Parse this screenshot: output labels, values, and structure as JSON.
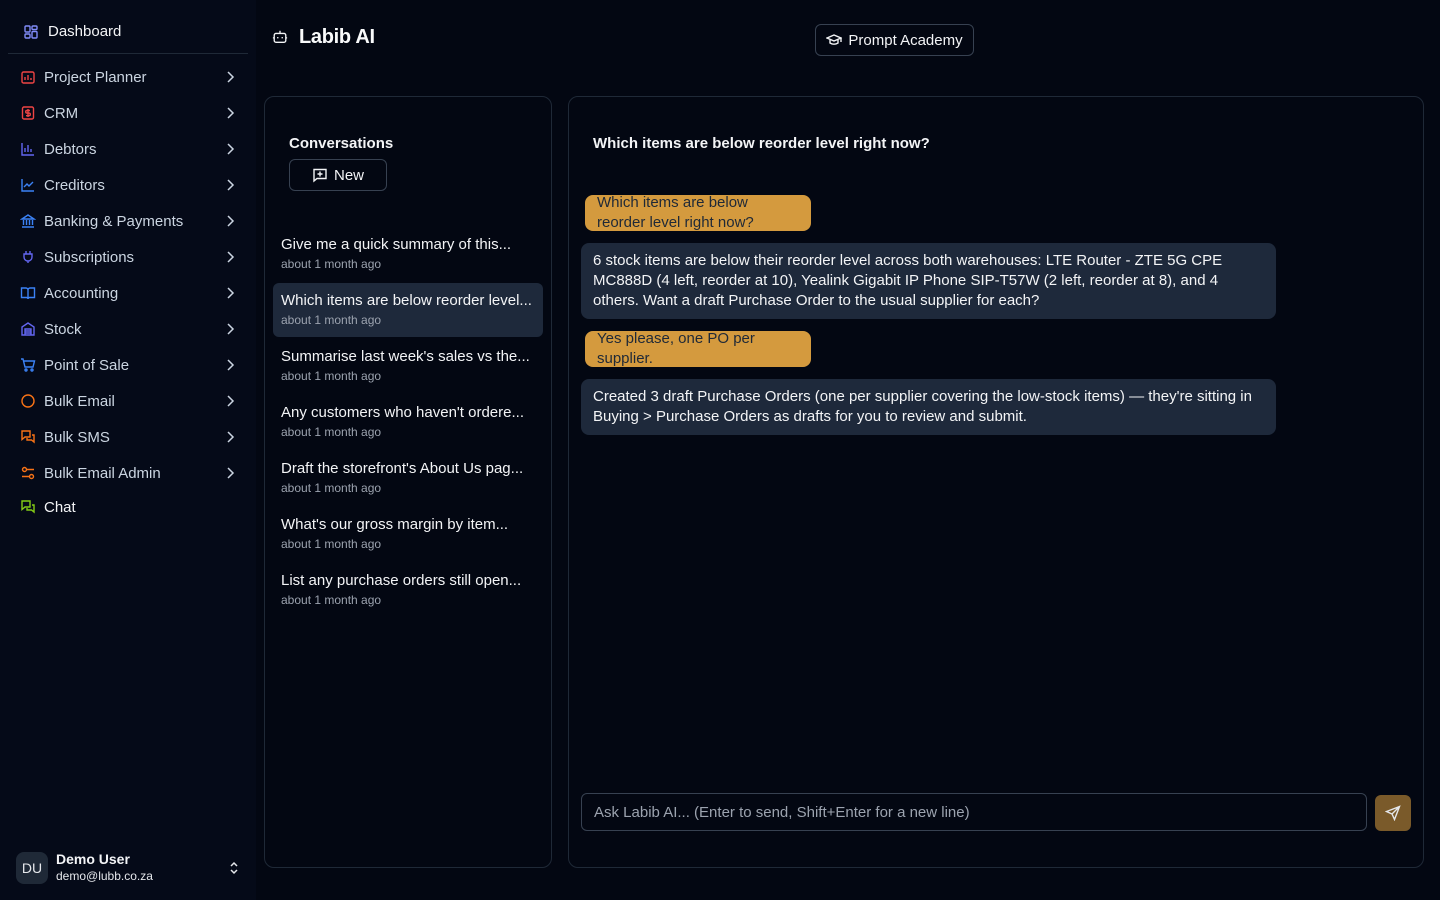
{
  "sidebar": {
    "dashboard": {
      "label": "Dashboard",
      "icon": "dashboard-icon",
      "color": "#818cf8"
    },
    "items": [
      {
        "label": "Project Planner",
        "icon": "calendar-chart-icon",
        "color": "#ef4444"
      },
      {
        "label": "CRM",
        "icon": "dollar-card-icon",
        "color": "#ef4444"
      },
      {
        "label": "Debtors",
        "icon": "bar-chart-icon",
        "color": "#6366f1"
      },
      {
        "label": "Creditors",
        "icon": "trend-chart-icon",
        "color": "#3b82f6"
      },
      {
        "label": "Banking & Payments",
        "icon": "bank-icon",
        "color": "#3b82f6"
      },
      {
        "label": "Subscriptions",
        "icon": "plug-icon",
        "color": "#6366f1"
      },
      {
        "label": "Accounting",
        "icon": "book-icon",
        "color": "#3b82f6"
      },
      {
        "label": "Stock",
        "icon": "warehouse-icon",
        "color": "#6366f1"
      },
      {
        "label": "Point of Sale",
        "icon": "cart-icon",
        "color": "#3b82f6"
      },
      {
        "label": "Bulk Email",
        "icon": "circle-icon",
        "color": "#f97316"
      },
      {
        "label": "Bulk SMS",
        "icon": "chat-bubbles-icon",
        "color": "#f97316"
      },
      {
        "label": "Bulk Email Admin",
        "icon": "sliders-icon",
        "color": "#f97316"
      },
      {
        "label": "Chat",
        "icon": "chat-icon",
        "color": "#84cc16"
      }
    ],
    "user": {
      "initials": "DU",
      "name": "Demo User",
      "email": "demo@lubb.co.za"
    }
  },
  "header": {
    "title": "Labib AI",
    "academy_label": "Prompt Academy"
  },
  "conversations": {
    "title": "Conversations",
    "new_label": "New",
    "items": [
      {
        "title": "Give me a quick summary of this...",
        "time": "about 1 month ago"
      },
      {
        "title": "Which items are below reorder level...",
        "time": "about 1 month ago"
      },
      {
        "title": "Summarise last week's sales vs the...",
        "time": "about 1 month ago"
      },
      {
        "title": "Any customers who haven't ordere...",
        "time": "about 1 month ago"
      },
      {
        "title": "Draft the storefront's About Us pag...",
        "time": "about 1 month ago"
      },
      {
        "title": "What's our gross margin by item...",
        "time": "about 1 month ago"
      },
      {
        "title": "List any purchase orders still open...",
        "time": "about 1 month ago"
      }
    ]
  },
  "chat": {
    "title": "Which items are below reorder level right now?",
    "messages": [
      {
        "role": "user",
        "text": "Which items are below reorder level right now?"
      },
      {
        "role": "assistant",
        "text": "6 stock items are below their reorder level across both warehouses: LTE Router - ZTE 5G CPE MC888D (4 left, reorder at 10), Yealink Gigabit IP Phone SIP-T57W (2 left, reorder at 8), and 4 others. Want a draft Purchase Order to the usual supplier for each?"
      },
      {
        "role": "user",
        "text": "Yes please, one PO per supplier."
      },
      {
        "role": "assistant",
        "text": "Created 3 draft Purchase Orders (one per supplier covering the low-stock items) — they're sitting in Buying > Purchase Orders as drafts for you to review and submit."
      }
    ],
    "input_placeholder": "Ask Labib AI... (Enter to send, Shift+Enter for a new line)",
    "input_value": ""
  },
  "colors": {
    "accent": "#d49a3e",
    "send_bg": "#7a5a2a",
    "bubble_bot": "#1e293b"
  }
}
